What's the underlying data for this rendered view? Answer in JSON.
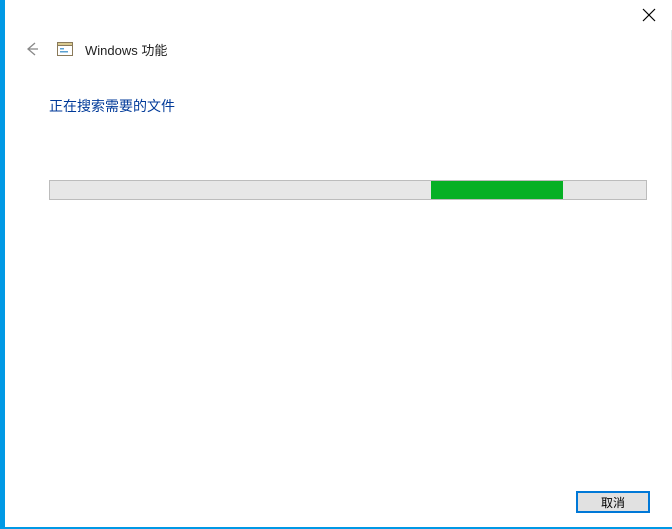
{
  "window": {
    "title": "Windows 功能"
  },
  "content": {
    "status": "正在搜索需要的文件"
  },
  "progress": {
    "indeterminate_left_pct": 64,
    "indeterminate_width_pct": 22
  },
  "footer": {
    "cancel_label": "取消"
  }
}
